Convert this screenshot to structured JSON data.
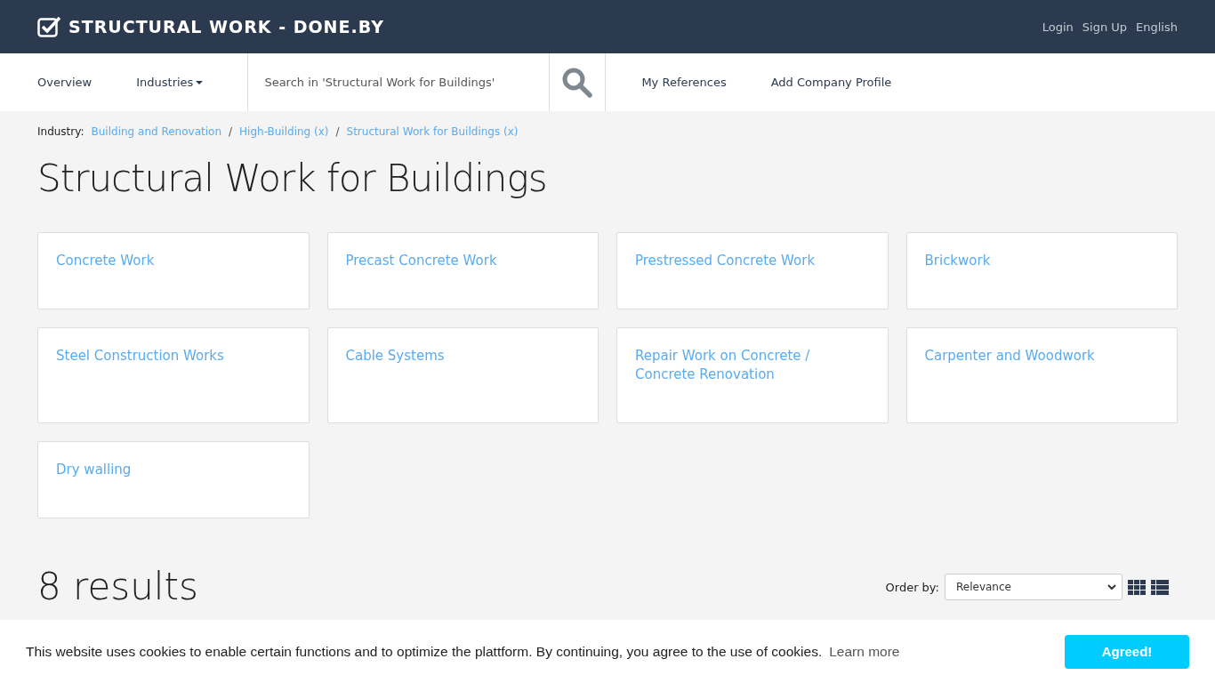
{
  "brand": {
    "title": "STRUCTURAL WORK - DONE.BY"
  },
  "top_links": [
    "Login",
    "Sign Up",
    "English"
  ],
  "nav": {
    "items": [
      {
        "label": "Overview",
        "dropdown": false
      },
      {
        "label": "Industries",
        "dropdown": true
      }
    ],
    "search": {
      "placeholder": "Search in 'Structural Work for Buildings'"
    },
    "links": [
      "My References",
      "Add Company Profile"
    ]
  },
  "breadcrumb": {
    "label": "Industry:",
    "separator": "/",
    "items": [
      "Building and Renovation",
      "High-Building (x)",
      "Structural Work for Buildings (x)"
    ]
  },
  "heading": "Structural Work for Buildings",
  "categories": [
    {
      "label": "Concrete Work"
    },
    {
      "label": "Precast Concrete Work"
    },
    {
      "label": "Prestressed Concrete Work"
    },
    {
      "label": "Brickwork"
    },
    {
      "label": "Steel Construction Works"
    },
    {
      "label": "Cable Systems"
    },
    {
      "label": "Repair Work on Concrete / Concrete Renovation"
    },
    {
      "label": "Carpenter and Woodwork"
    },
    {
      "label": "Dry walling"
    }
  ],
  "results": {
    "count": "8 results",
    "order_label": "Order by:",
    "order_value": "Relevance",
    "views": [
      {
        "kind": "grid",
        "selected": true
      },
      {
        "kind": "list",
        "selected": true
      }
    ]
  },
  "cookie_banner": {
    "message": "This website uses cookies to enable certain functions and to optimize the plattform. By continuing, you agree to the use of cookies.",
    "link": "Learn more",
    "button": "Agreed!"
  }
}
